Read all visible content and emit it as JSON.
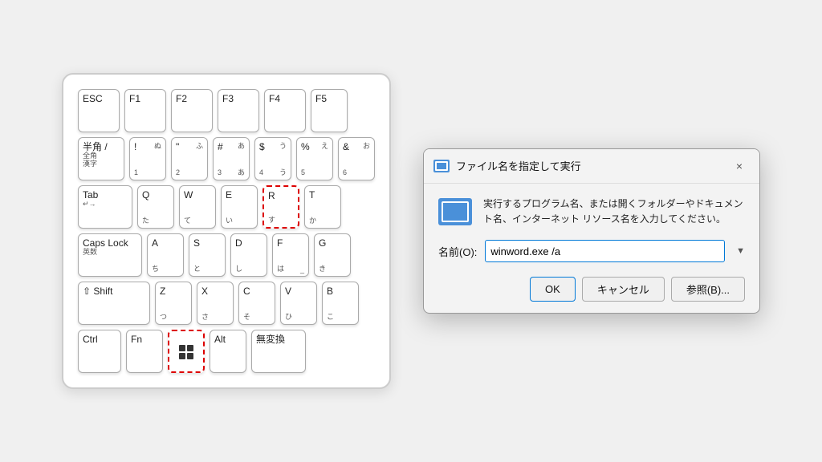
{
  "keyboard": {
    "rows": [
      {
        "keys": [
          {
            "id": "esc",
            "main": "ESC",
            "sub": "",
            "topRight": "",
            "bottomRight": "",
            "width": "esc"
          },
          {
            "id": "f1",
            "main": "F1",
            "sub": "",
            "topRight": "",
            "bottomRight": "",
            "width": "f"
          },
          {
            "id": "f2",
            "main": "F2",
            "sub": "",
            "topRight": "",
            "bottomRight": "",
            "width": "f"
          },
          {
            "id": "f3",
            "main": "F3",
            "sub": "",
            "topRight": "",
            "bottomRight": "",
            "width": "f"
          },
          {
            "id": "f4",
            "main": "F4",
            "sub": "",
            "topRight": "",
            "bottomRight": "",
            "width": "f"
          },
          {
            "id": "f5",
            "main": "F5",
            "sub": "",
            "topRight": "",
            "bottomRight": "",
            "width": "f5"
          }
        ]
      },
      {
        "keys": [
          {
            "id": "hankaku",
            "main": "半角 /",
            "sub": "全角\n漢字",
            "topRight": "",
            "bottomRight": "",
            "width": "hankaku"
          },
          {
            "id": "1",
            "main": "!",
            "sub": "1",
            "topRight": "ぬ",
            "bottomRight": "",
            "width": "normal"
          },
          {
            "id": "2",
            "main": "\"",
            "sub": "2",
            "topRight": "ふ",
            "bottomRight": "",
            "width": "normal"
          },
          {
            "id": "3",
            "main": "#",
            "sub": "3",
            "topRight": "あ",
            "bottomRight": "あ",
            "width": "normal"
          },
          {
            "id": "4",
            "main": "$",
            "sub": "4",
            "topRight": "う",
            "bottomRight": "う",
            "width": "normal"
          },
          {
            "id": "5",
            "main": "%",
            "sub": "5",
            "topRight": "え",
            "bottomRight": "",
            "width": "normal"
          },
          {
            "id": "6",
            "main": "&",
            "sub": "6",
            "topRight": "お",
            "bottomRight": "",
            "width": "normal"
          }
        ]
      },
      {
        "keys": [
          {
            "id": "tab",
            "main": "Tab",
            "sub": "↵→",
            "topRight": "",
            "bottomRight": "",
            "width": "tab"
          },
          {
            "id": "q",
            "main": "Q",
            "sub": "た",
            "topRight": "",
            "bottomRight": "",
            "width": "normal"
          },
          {
            "id": "w",
            "main": "W",
            "sub": "て",
            "topRight": "",
            "bottomRight": "",
            "width": "normal"
          },
          {
            "id": "e",
            "main": "E",
            "sub": "い",
            "topRight": "",
            "bottomRight": "",
            "width": "normal"
          },
          {
            "id": "r",
            "main": "R",
            "sub": "す",
            "topRight": "",
            "bottomRight": "",
            "width": "normal",
            "highlight": true
          },
          {
            "id": "t",
            "main": "T",
            "sub": "か",
            "topRight": "",
            "bottomRight": "",
            "width": "normal"
          }
        ]
      },
      {
        "keys": [
          {
            "id": "capslock",
            "main": "Caps Lock",
            "sub": "英数",
            "topRight": "",
            "bottomRight": "",
            "width": "capslock"
          },
          {
            "id": "a",
            "main": "A",
            "sub": "ち",
            "topRight": "",
            "bottomRight": "",
            "width": "normal"
          },
          {
            "id": "s",
            "main": "S",
            "sub": "と",
            "topRight": "",
            "bottomRight": "",
            "width": "normal"
          },
          {
            "id": "d",
            "main": "D",
            "sub": "し",
            "topRight": "",
            "bottomRight": "",
            "width": "normal"
          },
          {
            "id": "f",
            "main": "F",
            "sub": "は",
            "topRight": "",
            "bottomRight": "_",
            "width": "normal"
          },
          {
            "id": "g",
            "main": "G",
            "sub": "き",
            "topRight": "",
            "bottomRight": "",
            "width": "normal"
          }
        ]
      },
      {
        "keys": [
          {
            "id": "shift",
            "main": "⇧ Shift",
            "sub": "",
            "topRight": "",
            "bottomRight": "",
            "width": "shift"
          },
          {
            "id": "z",
            "main": "Z",
            "sub": "つ",
            "topRight": "",
            "bottomRight": "",
            "width": "normal"
          },
          {
            "id": "x",
            "main": "X",
            "sub": "さ",
            "topRight": "",
            "bottomRight": "",
            "width": "normal"
          },
          {
            "id": "c",
            "main": "C",
            "sub": "そ",
            "topRight": "",
            "bottomRight": "",
            "width": "normal"
          },
          {
            "id": "v",
            "main": "V",
            "sub": "ひ",
            "topRight": "",
            "bottomRight": "",
            "width": "normal"
          },
          {
            "id": "b",
            "main": "B",
            "sub": "こ",
            "topRight": "",
            "bottomRight": "",
            "width": "normal"
          }
        ]
      },
      {
        "keys": [
          {
            "id": "ctrl",
            "main": "Ctrl",
            "sub": "",
            "topRight": "",
            "bottomRight": "",
            "width": "ctrl"
          },
          {
            "id": "fn",
            "main": "Fn",
            "sub": "",
            "topRight": "",
            "bottomRight": "",
            "width": "fn"
          },
          {
            "id": "win",
            "main": "win",
            "sub": "",
            "topRight": "",
            "bottomRight": "",
            "width": "win",
            "highlight": true,
            "isWin": true
          },
          {
            "id": "alt",
            "main": "Alt",
            "sub": "",
            "topRight": "",
            "bottomRight": "",
            "width": "alt"
          },
          {
            "id": "muhenkan",
            "main": "無変換",
            "sub": "",
            "topRight": "",
            "bottomRight": "",
            "width": "muhenkan"
          }
        ]
      }
    ]
  },
  "dialog": {
    "title": "ファイル名を指定して実行",
    "close_label": "×",
    "description": "実行するプログラム名、または開くフォルダーやドキュメント名、インターネット リソース名を入力してください。",
    "input_label": "名前(O):",
    "input_value": "winword.exe /a",
    "input_placeholder": "",
    "ok_label": "OK",
    "cancel_label": "キャンセル",
    "browse_label": "参照(B)..."
  }
}
